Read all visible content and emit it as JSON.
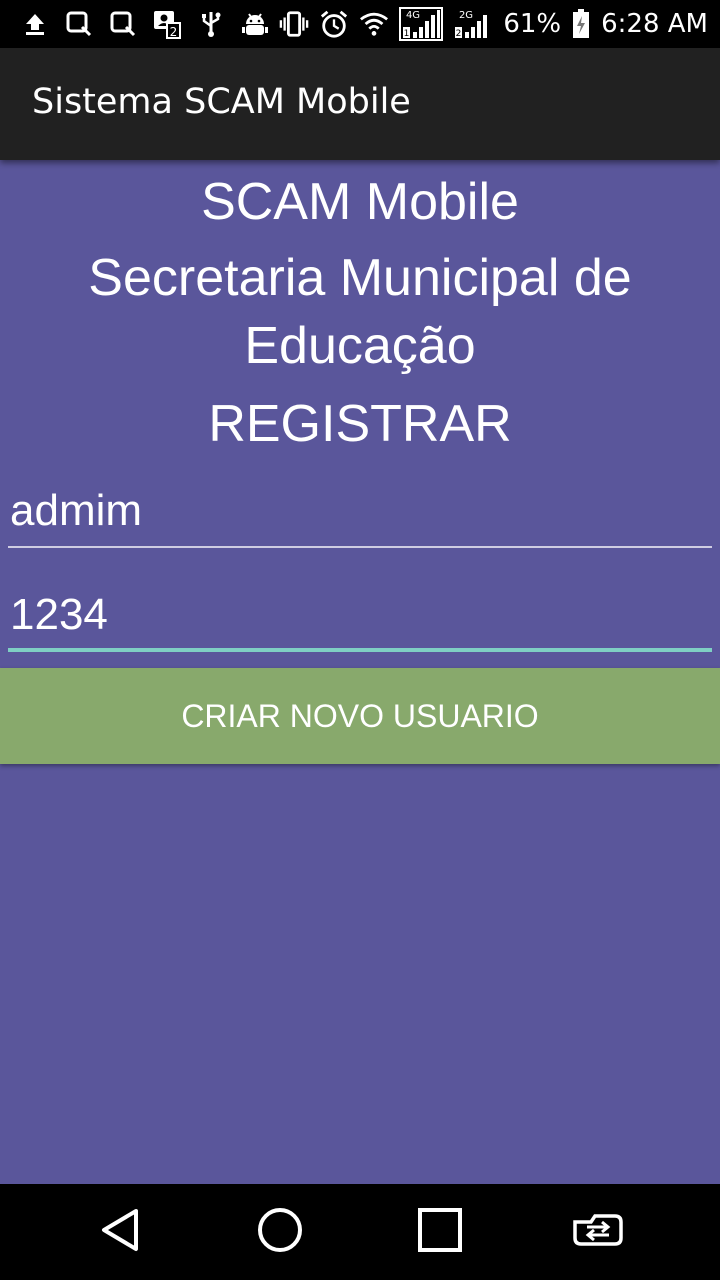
{
  "status_bar": {
    "left_icons": [
      "upload-icon",
      "screenshot-icon",
      "screenshot-icon",
      "sim-contacts-icon",
      "usb-icon",
      "android-debug-icon"
    ],
    "right_icons": [
      "vibrate-icon",
      "alarm-icon",
      "wifi-icon",
      "signal-4g-icon",
      "signal-2g-icon",
      "battery-charging-icon"
    ],
    "battery_percent": "61%",
    "time": "6:28 AM"
  },
  "app_bar": {
    "title": "Sistema SCAM Mobile"
  },
  "main": {
    "title": "SCAM Mobile",
    "organization": "Secretaria Municipal de Educação",
    "section_title": "REGISTRAR",
    "username_value": "admim",
    "password_value": "1234",
    "create_button_label": "CRIAR NOVO USUARIO"
  },
  "nav_bar": {
    "buttons": [
      "back-icon",
      "home-icon",
      "recents-icon",
      "app-switch-icon"
    ]
  },
  "colors": {
    "background": "#5a569b",
    "app_bar": "#212121",
    "button": "#88a96c",
    "focused_underline": "#7fcfc4"
  }
}
